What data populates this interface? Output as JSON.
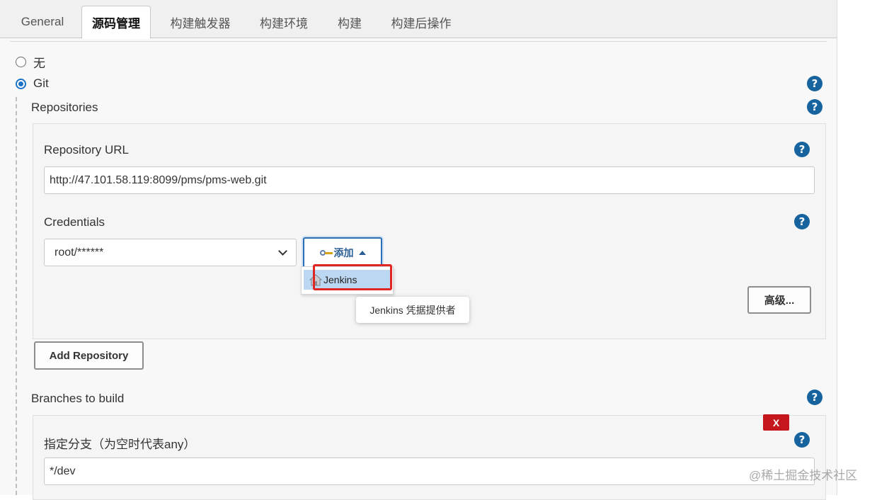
{
  "tabs": [
    "General",
    "源码管理",
    "构建触发器",
    "构建环境",
    "构建",
    "构建后操作"
  ],
  "active_tab": "源码管理",
  "scm": {
    "none_label": "无",
    "git_label": "Git",
    "selected": "Git"
  },
  "repositories": {
    "title": "Repositories",
    "url_label": "Repository URL",
    "url_value": "http://47.101.58.119:8099/pms/pms-web.git",
    "credentials_label": "Credentials",
    "credentials_value": "root/******",
    "add_button": "添加",
    "add_menu": {
      "item": "Jenkins",
      "tooltip": "Jenkins 凭据提供者"
    },
    "advanced_button": "高级...",
    "add_repository_button": "Add Repository"
  },
  "branches": {
    "title": "Branches to build",
    "branch_label": "指定分支（为空时代表any）",
    "branch_value": "*/dev",
    "delete_label": "X"
  },
  "help_glyph": "?",
  "watermark": "@稀土掘金技术社区",
  "colors": {
    "help": "#16639e",
    "highlight": "#e02525",
    "delete": "#c4161c",
    "menu_selected": "#bcd7f2"
  }
}
